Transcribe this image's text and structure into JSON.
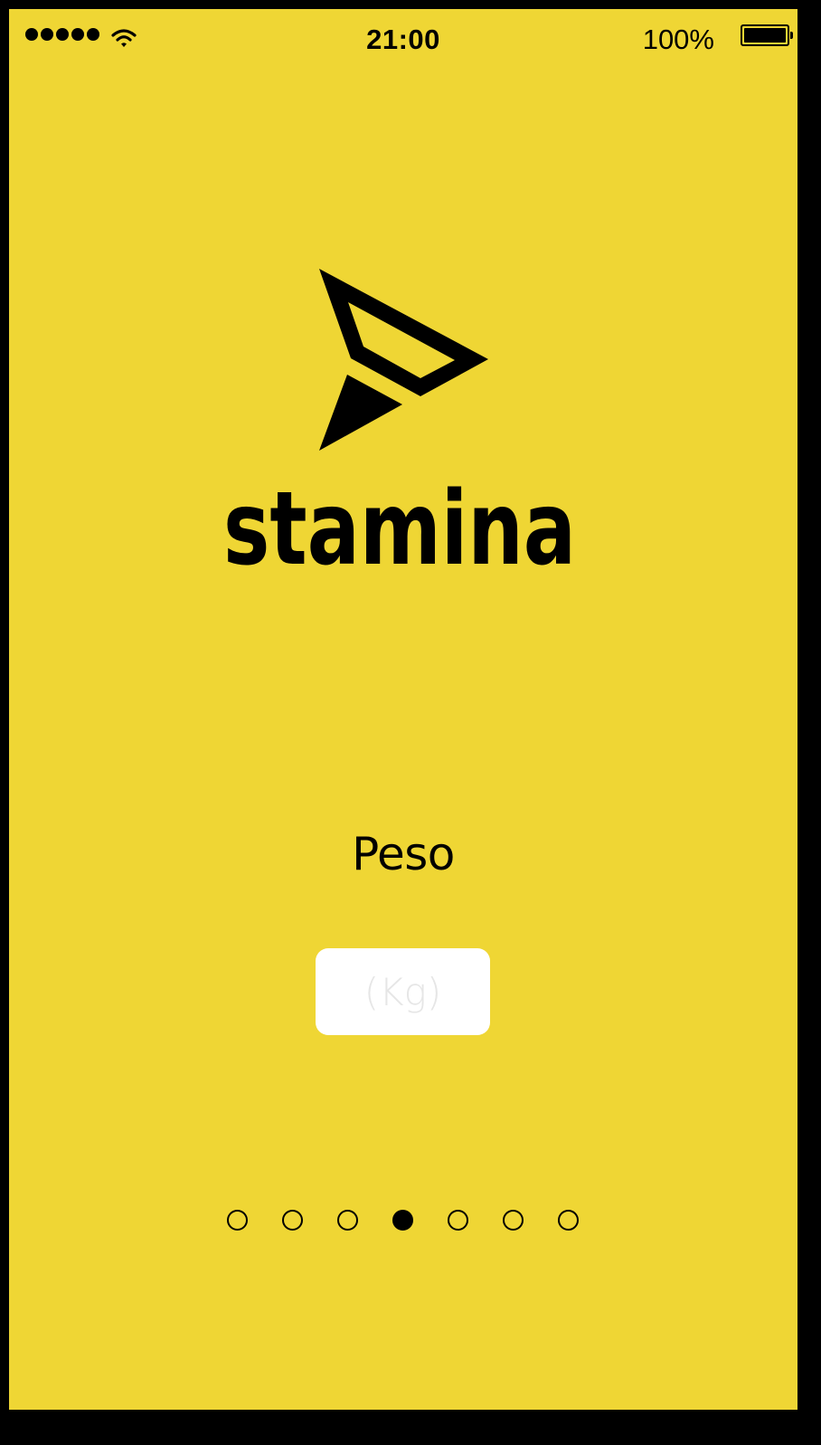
{
  "status_bar": {
    "time": "21:00",
    "battery_percent": "100%",
    "signal_bars": 5,
    "icons": [
      "signal-dots-icon",
      "wifi-icon",
      "battery-icon"
    ]
  },
  "brand": {
    "name": "stamina",
    "logo_icon": "arrow-triangle-logo-icon"
  },
  "form": {
    "label": "Peso",
    "input_placeholder": "(Kg)",
    "input_value": ""
  },
  "pager": {
    "total": 7,
    "current": 4
  },
  "colors": {
    "background": "#EFD634",
    "ink": "#000000",
    "input_bg": "#FFFFFF",
    "placeholder": "#E6E6E6"
  }
}
